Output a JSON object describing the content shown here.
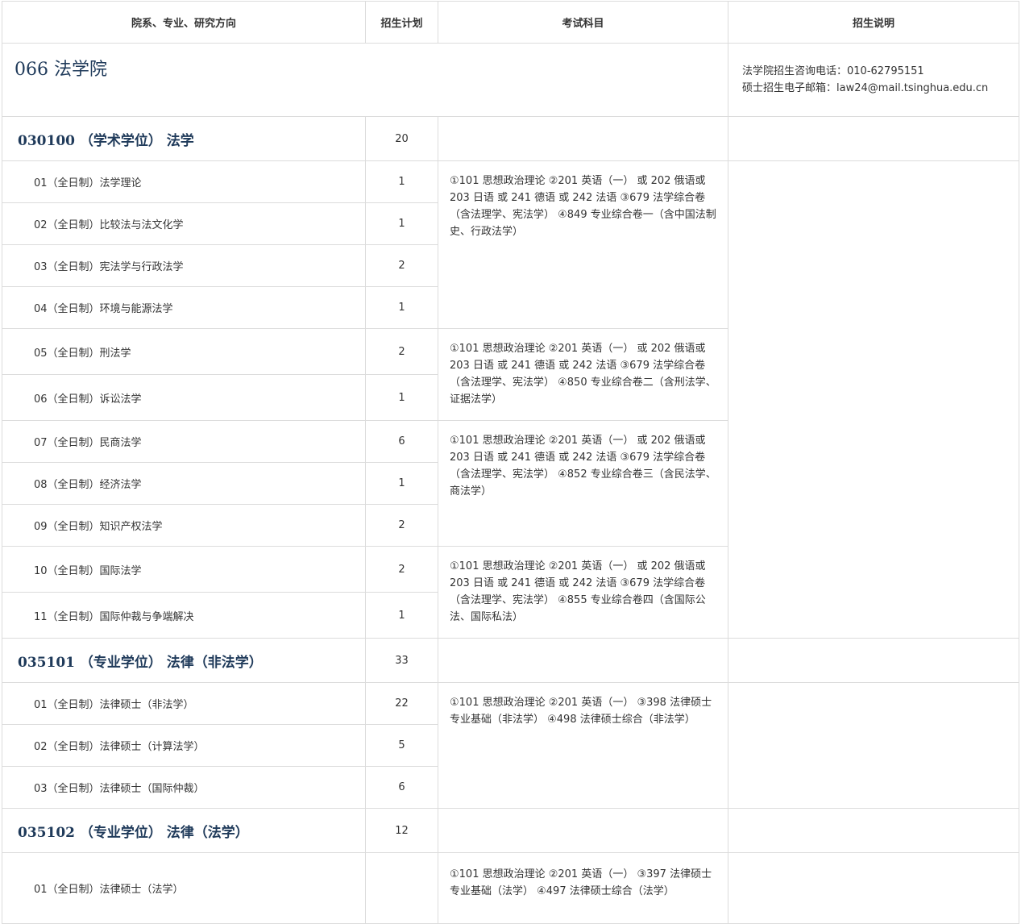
{
  "headers": [
    "院系、专业、研究方向",
    "招生计划",
    "考试科目",
    "招生说明"
  ],
  "department": {
    "name": "066  法学院",
    "contact_phone": "法学院招生咨询电话：010-62795151",
    "contact_email": "硕士招生电子邮箱：law24@mail.tsinghua.edu.cn"
  },
  "majors": [
    {
      "title": "030100 （学术学位） 法学",
      "plan": "20",
      "directions": [
        {
          "name": "01（全日制）法学理论",
          "plan": "1"
        },
        {
          "name": "02（全日制）比较法与法文化学",
          "plan": "1"
        },
        {
          "name": "03（全日制）宪法学与行政法学",
          "plan": "2"
        },
        {
          "name": "04（全日制）环境与能源法学",
          "plan": "1"
        },
        {
          "name": "05（全日制）刑法学",
          "plan": "2"
        },
        {
          "name": "06（全日制）诉讼法学",
          "plan": "1"
        },
        {
          "name": "07（全日制）民商法学",
          "plan": "6"
        },
        {
          "name": "08（全日制）经济法学",
          "plan": "1"
        },
        {
          "name": "09（全日制）知识产权法学",
          "plan": "2"
        },
        {
          "name": "10（全日制）国际法学",
          "plan": "2"
        },
        {
          "name": "11（全日制）国际仲裁与争端解决",
          "plan": "1"
        }
      ],
      "exams": [
        "①101 思想政治理论 ②201 英语（一） 或 202 俄语或 203 日语 或 241 德语 或 242 法语 ③679 法学综合卷（含法理学、宪法学） ④849 专业综合卷一（含中国法制史、行政法学）",
        "①101 思想政治理论 ②201 英语（一） 或 202 俄语或 203 日语 或 241 德语 或 242 法语 ③679 法学综合卷（含法理学、宪法学） ④850 专业综合卷二（含刑法学、证据法学）",
        "①101 思想政治理论 ②201 英语（一） 或 202 俄语或 203 日语 或 241 德语 或 242 法语 ③679 法学综合卷（含法理学、宪法学） ④852 专业综合卷三（含民法学、商法学）",
        "①101 思想政治理论 ②201 英语（一） 或 202 俄语或 203 日语 或 241 德语 或 242 法语 ③679 法学综合卷（含法理学、宪法学） ④855 专业综合卷四（含国际公法、国际私法）"
      ]
    },
    {
      "title": "035101 （专业学位） 法律（非法学）",
      "plan": "33",
      "directions": [
        {
          "name": "01（全日制）法律硕士（非法学）",
          "plan": "22"
        },
        {
          "name": "02（全日制）法律硕士（计算法学）",
          "plan": "5"
        },
        {
          "name": "03（全日制）法律硕士（国际仲裁）",
          "plan": "6"
        }
      ],
      "exams": [
        "①101 思想政治理论 ②201 英语（一） ③398 法律硕士专业基础（非法学） ④498 法律硕士综合（非法学）"
      ]
    },
    {
      "title": "035102 （专业学位） 法律（法学）",
      "plan": "12",
      "directions": [
        {
          "name": "01（全日制）法律硕士（法学）",
          "plan": ""
        }
      ],
      "exams": [
        "①101 思想政治理论 ②201 英语（一） ③397 法律硕士专业基础（法学） ④497 法律硕士综合（法学）"
      ]
    }
  ]
}
